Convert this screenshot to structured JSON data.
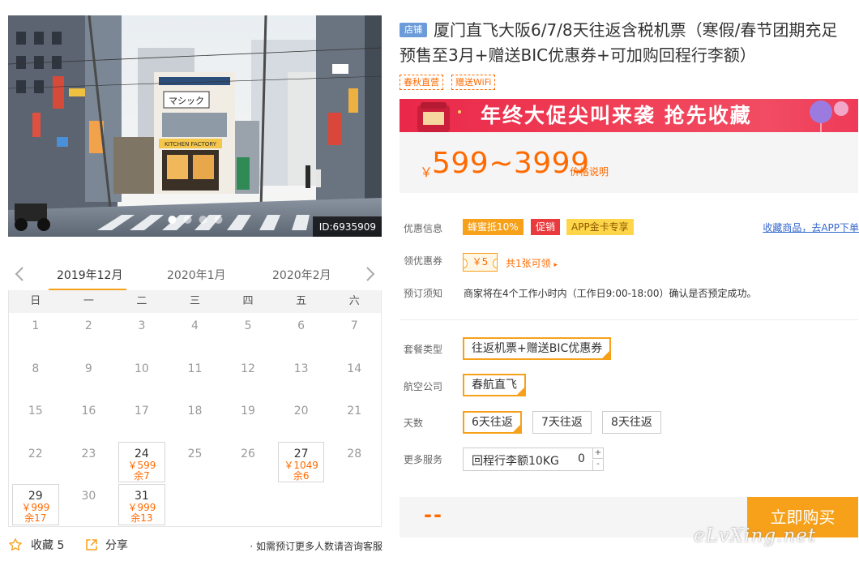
{
  "photo": {
    "id_label": "ID:6935909",
    "dot_count": 4,
    "active_dot": 0,
    "shop_sign": "マシック",
    "shop_sub": "KITCHEN FACTORY"
  },
  "calendar": {
    "prev_icon": "chevron-left-icon",
    "next_icon": "chevron-right-icon",
    "months": [
      "2019年12月",
      "2020年1月",
      "2020年2月"
    ],
    "active_month": 0,
    "weekdays": [
      "日",
      "一",
      "二",
      "三",
      "四",
      "五",
      "六"
    ],
    "cells": [
      {
        "day": "1"
      },
      {
        "day": "2"
      },
      {
        "day": "3"
      },
      {
        "day": "4"
      },
      {
        "day": "5"
      },
      {
        "day": "6"
      },
      {
        "day": "7"
      },
      {
        "day": "8"
      },
      {
        "day": "9"
      },
      {
        "day": "10"
      },
      {
        "day": "11"
      },
      {
        "day": "12"
      },
      {
        "day": "13"
      },
      {
        "day": "14"
      },
      {
        "day": "15"
      },
      {
        "day": "16"
      },
      {
        "day": "17"
      },
      {
        "day": "18"
      },
      {
        "day": "19"
      },
      {
        "day": "20"
      },
      {
        "day": "21"
      },
      {
        "day": "22"
      },
      {
        "day": "23"
      },
      {
        "day": "24",
        "price": "￥599",
        "remaining": "余7"
      },
      {
        "day": "25"
      },
      {
        "day": "26"
      },
      {
        "day": "27",
        "price": "￥1049",
        "remaining": "余6"
      },
      {
        "day": "28"
      },
      {
        "day": "29",
        "price": "￥999",
        "remaining": "余17"
      },
      {
        "day": "30"
      },
      {
        "day": "31",
        "price": "￥999",
        "remaining": "余13"
      }
    ]
  },
  "footer_left": {
    "favorite_label": "收藏 5",
    "favorite_icon": "star-icon",
    "share_label": "分享",
    "share_icon": "share-icon",
    "consult_text": "· 如需预订更多人数请咨询客服"
  },
  "product": {
    "shop_badge": "店铺",
    "title": "厦门直飞大阪6/7/8天往返含税机票（寒假/春节团期充足预售至3月+赠送BIC优惠券+可加购回程行李额）",
    "tags": [
      "春秋直营",
      "赠送WiFi"
    ]
  },
  "banner": {
    "text": "年终大促尖叫来袭  抢先收藏",
    "colors": {
      "bg": "#ee3456",
      "text": "#ffffff"
    }
  },
  "price": {
    "currency": "￥",
    "range": "599~3999",
    "note": "价格说明",
    "color": "#ff6a00"
  },
  "info": {
    "discount_label": "优惠信息",
    "badges": [
      {
        "text": "蜂蜜抵10%",
        "color": "#f7a11a"
      },
      {
        "text": "促销",
        "color": "#e93b3d"
      },
      {
        "text": "APP金卡专享",
        "color": "#ffd54a"
      }
    ],
    "fav_link": "收藏商品，去APP下单",
    "coupon_label": "领优惠券",
    "coupon_value": "￥5",
    "coupon_link": "共1张可领",
    "notice_label": "预订须知",
    "notice_text": "商家将在4个工作小时内（工作日9:00-18:00）确认是否预定成功。"
  },
  "options": {
    "package_label": "套餐类型",
    "package_items": [
      "往返机票+赠送BIC优惠券"
    ],
    "package_selected": 0,
    "airline_label": "航空公司",
    "airline_items": [
      "春航直飞"
    ],
    "airline_selected": 0,
    "days_label": "天数",
    "days_items": [
      "6天往返",
      "7天往返",
      "8天往返"
    ],
    "days_selected": 0,
    "service_label": "更多服务",
    "service_item": "回程行李额10KG",
    "service_qty": "0",
    "plus": "+",
    "minus": "-"
  },
  "buy": {
    "total": "--",
    "button": "立即购买",
    "accent": "#f7a11a"
  },
  "watermark": "eLvXing.net"
}
